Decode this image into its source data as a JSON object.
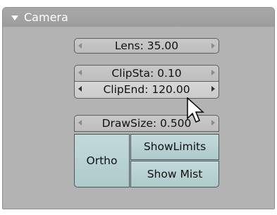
{
  "panel": {
    "title": "Camera",
    "collapse_icon": "triangle-down-icon"
  },
  "fields": {
    "lens": "Lens: 35.00",
    "clip_start": "ClipSta: 0.10",
    "clip_end": "ClipEnd: 120.00",
    "draw_size": "DrawSize: 0.500"
  },
  "toggles": {
    "ortho": "Ortho",
    "show_limits": "ShowLimits",
    "show_mist": "Show Mist"
  },
  "icons": {
    "decrement": "arrow-left-icon",
    "increment": "arrow-right-icon",
    "cursor": "mouse-pointer-icon"
  }
}
